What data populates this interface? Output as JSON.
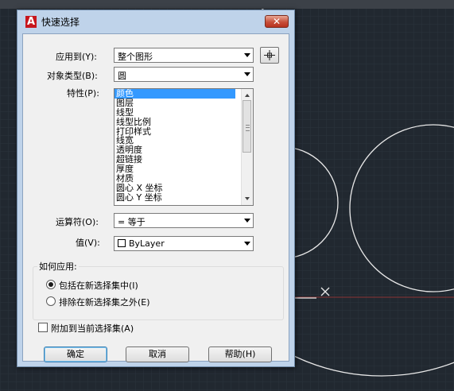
{
  "dialog": {
    "title": "快速选择",
    "close_label": "✕"
  },
  "apply_to": {
    "label": "应用到(Y):",
    "value": "整个图形"
  },
  "object_type": {
    "label": "对象类型(B):",
    "value": "圆"
  },
  "properties": {
    "label": "特性(P):",
    "items": [
      "颜色",
      "图层",
      "线型",
      "线型比例",
      "打印样式",
      "线宽",
      "透明度",
      "超链接",
      "厚度",
      "材质",
      "圆心 X 坐标",
      "圆心 Y 坐标"
    ],
    "selected": "颜色"
  },
  "operator": {
    "label": "运算符(O):",
    "value": "= 等于"
  },
  "value": {
    "label": "值(V):",
    "value": "ByLayer"
  },
  "how_to_apply": {
    "label": "如何应用:",
    "option_include": "包括在新选择集中(I)",
    "option_exclude": "排除在新选择集之外(E)",
    "selected": "include"
  },
  "append_checkbox": {
    "label": "附加到当前选择集(A)",
    "checked": false
  },
  "buttons": {
    "ok": "确定",
    "cancel": "取消",
    "help": "帮助(H)"
  },
  "colors": {
    "canvas_bg": "#212830",
    "canvas_lines": "#e8e8e8",
    "title_bar": "#bfd3ea",
    "selection": "#3399ff",
    "x_axis": "#b03a3a"
  }
}
